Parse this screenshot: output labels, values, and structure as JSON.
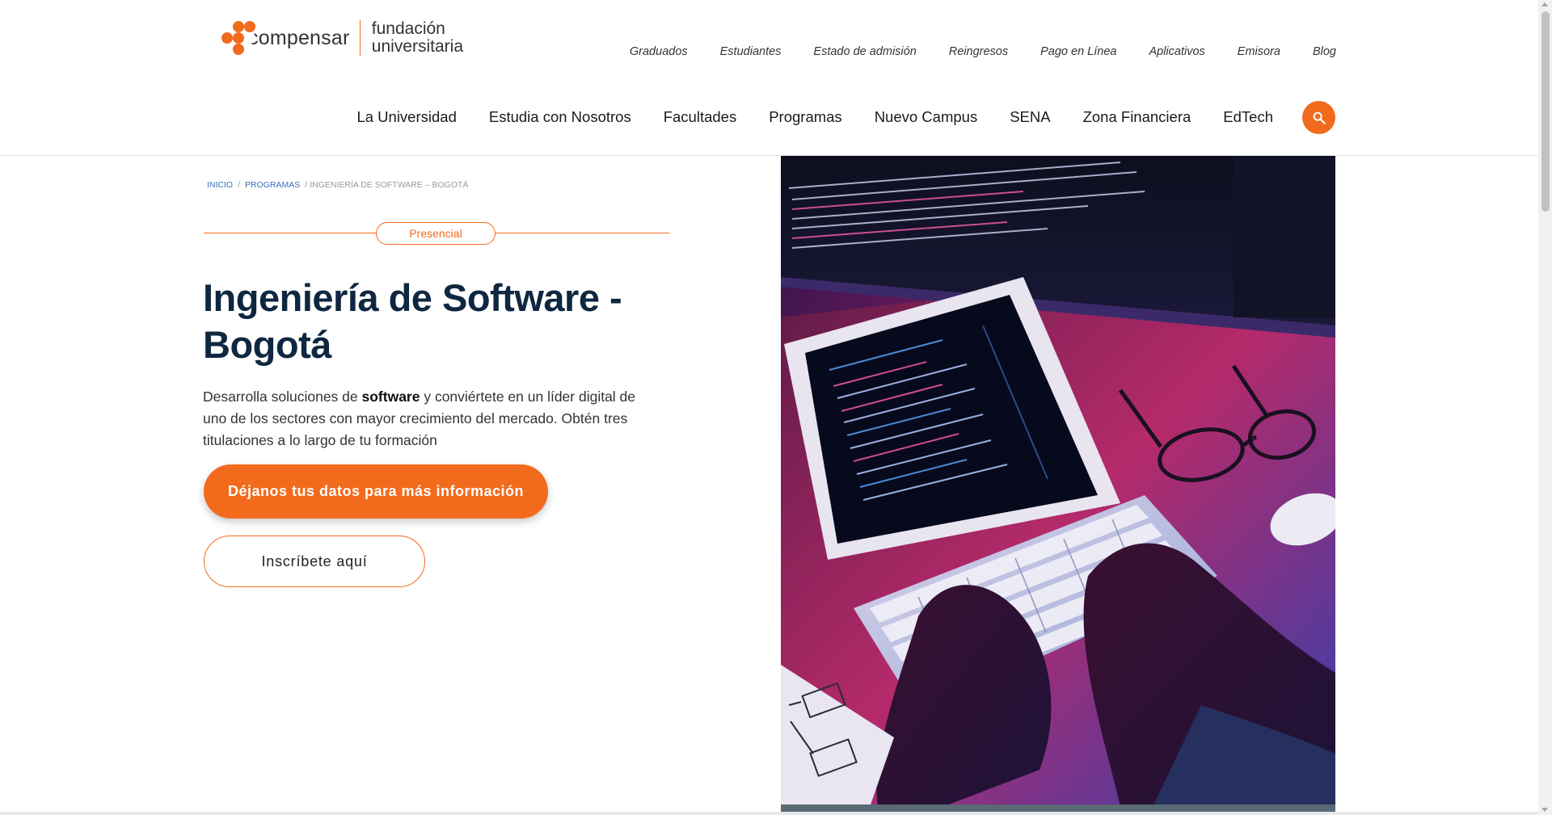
{
  "brand": {
    "name": "compensar",
    "subtitle_line1": "fundación",
    "subtitle_line2": "universitaria",
    "accent_color": "#f26b1d"
  },
  "top_nav": [
    {
      "label": "Graduados"
    },
    {
      "label": "Estudiantes"
    },
    {
      "label": "Estado de admisión"
    },
    {
      "label": "Reingresos"
    },
    {
      "label": "Pago en Línea"
    },
    {
      "label": "Aplicativos"
    },
    {
      "label": "Emisora"
    },
    {
      "label": "Blog"
    }
  ],
  "main_nav": [
    {
      "label": "La Universidad"
    },
    {
      "label": "Estudia con Nosotros"
    },
    {
      "label": "Facultades"
    },
    {
      "label": "Programas"
    },
    {
      "label": "Nuevo Campus"
    },
    {
      "label": "SENA"
    },
    {
      "label": "Zona Financiera"
    },
    {
      "label": "EdTech"
    }
  ],
  "search": {
    "icon": "search-icon"
  },
  "breadcrumb": {
    "home": "INICIO",
    "section": "PROGRAMAS",
    "current": "INGENIERÍA DE SOFTWARE – BOGOTÁ"
  },
  "program": {
    "modality": "Presencial",
    "title_line1": "Ingeniería de Software -",
    "title_line2": "Bogotá",
    "description_before": "Desarrolla soluciones de ",
    "description_bold": "software",
    "description_after": " y conviértete en un líder digital de uno de los sectores con mayor crecimiento del mercado. Obtén tres titulaciones a lo largo de tu formación"
  },
  "cta": {
    "primary_label": "Déjanos tus datos para más información",
    "secondary_label": "Inscríbete aquí"
  }
}
